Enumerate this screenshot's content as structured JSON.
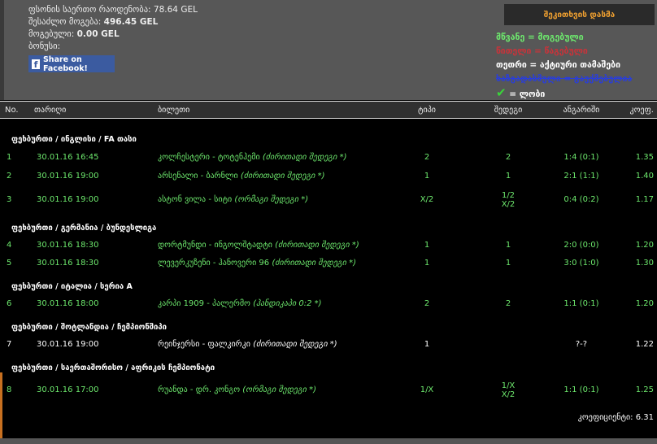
{
  "summary": {
    "total_stake_label": "ფსონის საერთო რაოდენობა:",
    "total_stake": "78.64 GEL",
    "possible_win_label": "შესაძლო მოგება:",
    "possible_win": "496.45 GEL",
    "won_label": "მოგებული:",
    "won": "0.00 GEL",
    "bonus_label": "ბონუსი:",
    "facebook_share": "Share on Facebook!"
  },
  "ask_question_button": "შეკითხვის დასმა",
  "legend": {
    "green": "მწვანე = მოგებული",
    "red": "წითელი = წაგებული",
    "white": "თეთრი = აქტიური თამაშები",
    "blue": "ხაზგადასმული = გაუქმებულია",
    "check": "= ლობი"
  },
  "colors": {
    "won": "#6de86d",
    "lost": "#c8333a",
    "active": "#ffffff",
    "cancelled": "#2a3ed8",
    "ask_text": "#f0a030"
  },
  "table": {
    "headers": [
      "No.",
      "თარიღი",
      "ბილეთი",
      "ტიპი",
      "შედეგი",
      "ანგარიში",
      "კოეფ."
    ],
    "groups": [
      {
        "title": "ფეხბურთი / ინგლისი / FA თასი",
        "rows": [
          {
            "no": "1",
            "date": "30.01.16 16:45",
            "match": "კოლჩესტერი - ტოტენჰემი",
            "market": "(ძირითადი შედეგი *)",
            "type": "2",
            "result": "2",
            "result2": "",
            "score": "1:4 (0:1)",
            "odds": "1.35"
          },
          {
            "no": "2",
            "date": "30.01.16 19:00",
            "match": "არსენალი - ბარნლი",
            "market": "(ძირითადი შედეგი *)",
            "type": "1",
            "result": "1",
            "result2": "",
            "score": "2:1 (1:1)",
            "odds": "1.40"
          },
          {
            "no": "3",
            "date": "30.01.16 19:00",
            "match": "ასტონ ვილა - სიტი",
            "market": "(ორმაგი შედეგი *)",
            "type": "X/2",
            "result": "1/2",
            "result2": "X/2",
            "score": "0:4 (0:2)",
            "odds": "1.17"
          }
        ]
      },
      {
        "title": "ფეხბურთი / გერმანია / ბუნდესლიგა",
        "rows": [
          {
            "no": "4",
            "date": "30.01.16 18:30",
            "match": "დორტმუნდი - ინგოლშტადტი",
            "market": "(ძირითადი შედეგი *)",
            "type": "1",
            "result": "1",
            "result2": "",
            "score": "2:0 (0:0)",
            "odds": "1.20"
          },
          {
            "no": "5",
            "date": "30.01.16 18:30",
            "match": "ლევერკუზენი - ჰანოვერი 96",
            "market": "(ძირითადი შედეგი *)",
            "type": "1",
            "result": "1",
            "result2": "",
            "score": "3:0 (1:0)",
            "odds": "1.30"
          }
        ]
      },
      {
        "title": "ფეხბურთი / იტალია / სერია A",
        "rows": [
          {
            "no": "6",
            "date": "30.01.16 18:00",
            "match": "კარპი 1909 - პალერმო",
            "market": "(ჰანდიკაპი 0:2 *)",
            "type": "2",
            "result": "2",
            "result2": "",
            "score": "1:1 (0:1)",
            "odds": "1.20"
          }
        ]
      },
      {
        "title": "ფეხბურთი / შოტლანდია / ჩემპიონშიპი",
        "rows": [
          {
            "no": "7",
            "date": "30.01.16 19:00",
            "match": "რეინჯერსი - ფალკირკი",
            "market": "(ძირითადი შედეგი *)",
            "type": "1",
            "result": "",
            "result2": "",
            "score": "?-?",
            "odds": "1.22",
            "status": "active"
          }
        ]
      },
      {
        "title": "ფეხბურთი / საერთაშორისო / აფრიკის ჩემპიონატი",
        "rows": [
          {
            "no": "8",
            "date": "30.01.16 17:00",
            "match": "რუანდა - დრ. კონგო",
            "market": "(ორმაგი შედეგი *)",
            "type": "1/X",
            "result": "1/X",
            "result2": "X/2",
            "score": "1:1 (0:1)",
            "odds": "1.25"
          }
        ]
      }
    ]
  },
  "total_odds": "კოეფიციენტი: 6.31"
}
